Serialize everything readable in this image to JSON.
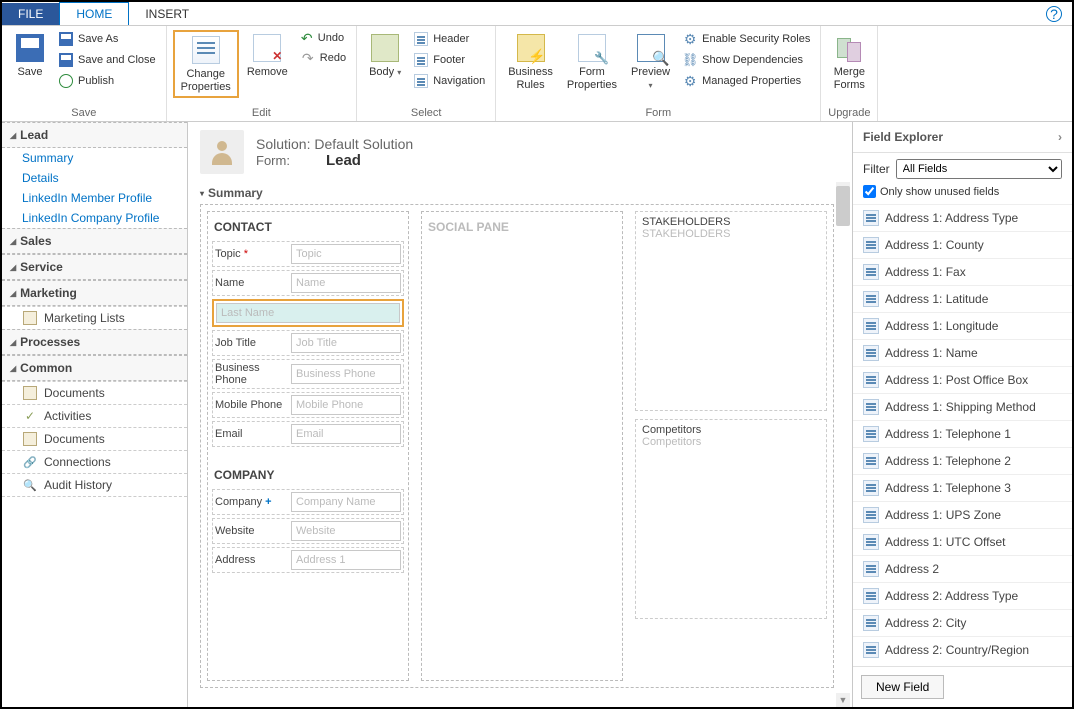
{
  "tabs": {
    "file": "FILE",
    "home": "HOME",
    "insert": "INSERT"
  },
  "ribbon": {
    "save": {
      "big": "Save",
      "saveAs": "Save As",
      "saveClose": "Save and Close",
      "publish": "Publish",
      "group": "Save"
    },
    "edit": {
      "changeProps": "Change\nProperties",
      "remove": "Remove",
      "undo": "Undo",
      "redo": "Redo",
      "group": "Edit"
    },
    "select": {
      "body": "Body",
      "header": "Header",
      "footer": "Footer",
      "nav": "Navigation",
      "group": "Select"
    },
    "form": {
      "rules": "Business\nRules",
      "props": "Form\nProperties",
      "preview": "Preview",
      "sec": "Enable Security Roles",
      "dep": "Show Dependencies",
      "man": "Managed Properties",
      "group": "Form"
    },
    "upgrade": {
      "merge": "Merge\nForms",
      "group": "Upgrade"
    }
  },
  "leftNav": {
    "lead": {
      "title": "Lead",
      "links": [
        "Summary",
        "Details",
        "LinkedIn Member Profile",
        "LinkedIn Company Profile"
      ]
    },
    "sales": "Sales",
    "service": "Service",
    "marketing": {
      "title": "Marketing",
      "items": [
        "Marketing Lists"
      ]
    },
    "processes": "Processes",
    "common": {
      "title": "Common",
      "items": [
        "Documents",
        "Activities",
        "Documents",
        "Connections",
        "Audit History"
      ]
    }
  },
  "canvas": {
    "solutionLabel": "Solution:",
    "solutionName": "Default Solution",
    "formLabel": "Form:",
    "formName": "Lead",
    "summary": "Summary",
    "contact": {
      "title": "CONTACT",
      "fields": [
        {
          "label": "Topic",
          "ph": "Topic",
          "req": true
        },
        {
          "label": "Name",
          "ph": "Name"
        },
        {
          "label": "",
          "ph": "Last Name",
          "full": true,
          "hl": true
        },
        {
          "label": "Job Title",
          "ph": "Job Title"
        },
        {
          "label": "Business Phone",
          "ph": "Business Phone"
        },
        {
          "label": "Mobile Phone",
          "ph": "Mobile Phone"
        },
        {
          "label": "Email",
          "ph": "Email"
        }
      ]
    },
    "company": {
      "title": "COMPANY",
      "fields": [
        {
          "label": "Company",
          "ph": "Company Name",
          "rec": true
        },
        {
          "label": "Website",
          "ph": "Website"
        },
        {
          "label": "Address",
          "ph": "Address 1"
        }
      ]
    },
    "socialPane": "SOCIAL PANE",
    "stakeholders": {
      "title": "STAKEHOLDERS",
      "ghost": "STAKEHOLDERS"
    },
    "competitors": {
      "title": "Competitors",
      "ghost": "Competitors"
    }
  },
  "fieldExplorer": {
    "title": "Field Explorer",
    "filterLabel": "Filter",
    "filterValue": "All Fields",
    "unusedLabel": "Only show unused fields",
    "items": [
      "Address 1: Address Type",
      "Address 1: County",
      "Address 1: Fax",
      "Address 1: Latitude",
      "Address 1: Longitude",
      "Address 1: Name",
      "Address 1: Post Office Box",
      "Address 1: Shipping Method",
      "Address 1: Telephone 1",
      "Address 1: Telephone 2",
      "Address 1: Telephone 3",
      "Address 1: UPS Zone",
      "Address 1: UTC Offset",
      "Address 2",
      "Address 2: Address Type",
      "Address 2: City",
      "Address 2: Country/Region"
    ],
    "newField": "New Field"
  }
}
